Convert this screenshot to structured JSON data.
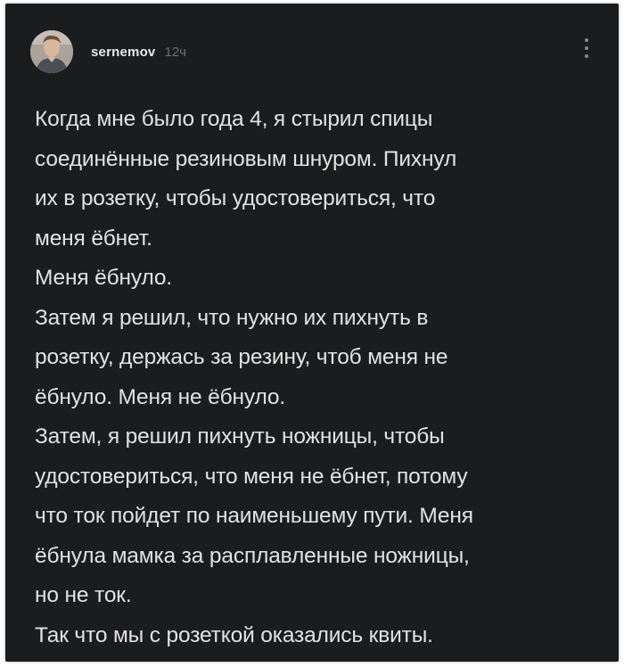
{
  "post": {
    "author": "sernemov",
    "time": "12ч",
    "lines": [
      "Когда мне было года 4, я стырил спицы",
      "соединённые резиновым шнуром. Пихнул",
      "их в розетку, чтобы удостовериться, что",
      "меня ёбнет.",
      "Меня ёбнуло.",
      "Затем я решил, что нужно их пихнуть в",
      "розетку, держась за резину, чтоб меня не",
      "ёбнуло. Меня не ёбнуло.",
      "Затем, я решил пихнуть ножницы, чтобы",
      "удостовериться, что меня не ёбнет, потому",
      "что ток пойдет по наименьшему пути. Меня",
      "ёбнула мамка за расплавленные ножницы,",
      "но не ток.",
      "Так что мы с розеткой оказались квиты."
    ]
  },
  "icons": {
    "avatar": "user-photo",
    "menu": "more-vertical-icon"
  },
  "colors": {
    "card_background": "#1b1c1e",
    "text": "#e2e2e2",
    "muted": "#6f6f72"
  }
}
